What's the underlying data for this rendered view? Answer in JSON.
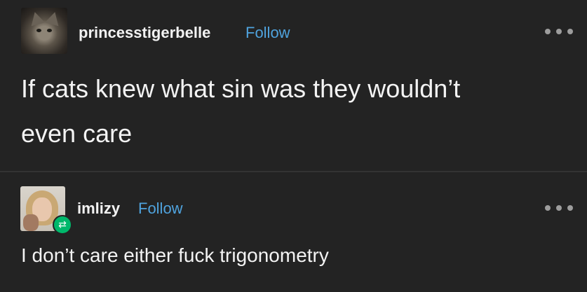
{
  "posts": [
    {
      "username": "princesstigerbelle",
      "follow_label": "Follow",
      "avatar_icon": "cat-avatar-icon",
      "text_lines": [
        "If cats knew what sin was they wouldn’t",
        "even care"
      ]
    },
    {
      "username": "imlizy",
      "follow_label": "Follow",
      "avatar_icon": "user-avatar-icon",
      "reblog_icon": "reblog-icon",
      "text_lines": [
        "I don’t care either fuck trigonometry"
      ]
    }
  ],
  "more_icon": "more-options-icon",
  "colors": {
    "background": "#232323",
    "text": "#f3f3f3",
    "follow": "#4fa3de",
    "reblog_badge": "#00b86b",
    "divider": "#333333"
  }
}
